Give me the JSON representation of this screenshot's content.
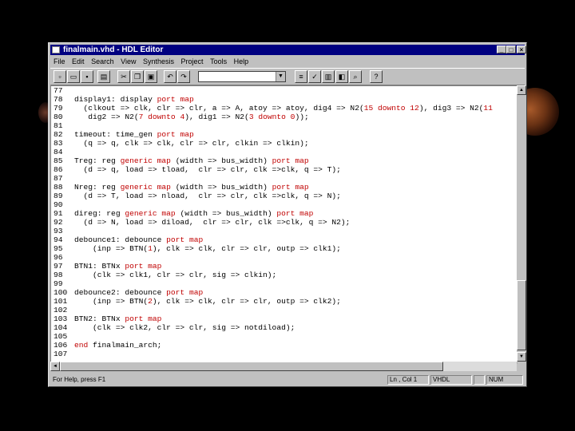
{
  "window": {
    "title": "finalmain.vhd - HDL Editor",
    "min": "_",
    "max": "□",
    "close": "×"
  },
  "menu": [
    "File",
    "Edit",
    "Search",
    "View",
    "Synthesis",
    "Project",
    "Tools",
    "Help"
  ],
  "toolbar": {
    "combo_value": "",
    "icons": [
      "new-file-icon",
      "open-folder-icon",
      "save-icon",
      "print-icon",
      "cut-icon",
      "copy-icon",
      "paste-icon",
      "undo-icon",
      "redo-icon",
      "compile-icon",
      "syntax-check-icon",
      "language-assistant-icon",
      "symbol-wizard-icon",
      "search-icon",
      "help-icon"
    ]
  },
  "editor": {
    "lines": [
      {
        "n": "77",
        "text": ""
      },
      {
        "n": "78",
        "text": "display1: display port map"
      },
      {
        "n": "79",
        "text": "  (clkout => clk, clr => clr, a => A, atoy => atoy, dig4 => N2(15 downto 12), dig3 => N2(11"
      },
      {
        "n": "80",
        "text": "   dig2 => N2(7 downto 4), dig1 => N2(3 downto 0));"
      },
      {
        "n": "81",
        "text": ""
      },
      {
        "n": "82",
        "text": "timeout: time_gen port map"
      },
      {
        "n": "83",
        "text": "  (q => q, clk => clk, clr => clr, clkin => clkin);"
      },
      {
        "n": "84",
        "text": ""
      },
      {
        "n": "85",
        "text": "Treg: reg generic map (width => bus_width) port map"
      },
      {
        "n": "86",
        "text": "  (d => q, load => tload,  clr => clr, clk =>clk, q => T);"
      },
      {
        "n": "87",
        "text": ""
      },
      {
        "n": "88",
        "text": "Nreg: reg generic map (width => bus_width) port map"
      },
      {
        "n": "89",
        "text": "  (d => T, load => nload,  clr => clr, clk =>clk, q => N);"
      },
      {
        "n": "90",
        "text": ""
      },
      {
        "n": "91",
        "text": "direg: reg generic map (width => bus_width) port map"
      },
      {
        "n": "92",
        "text": "  (d => N, load => diload,  clr => clr, clk =>clk, q => N2);"
      },
      {
        "n": "93",
        "text": ""
      },
      {
        "n": "94",
        "text": "debounce1: debounce port map"
      },
      {
        "n": "95",
        "text": "    (inp => BTN(1), clk => clk, clr => clr, outp => clk1);"
      },
      {
        "n": "96",
        "text": ""
      },
      {
        "n": "97",
        "text": "BTN1: BTNx port map"
      },
      {
        "n": "98",
        "text": "    (clk => clk1, clr => clr, sig => clkin);"
      },
      {
        "n": "99",
        "text": ""
      },
      {
        "n": "100",
        "text": "debounce2: debounce port map"
      },
      {
        "n": "101",
        "text": "    (inp => BTN(2), clk => clk, clr => clr, outp => clk2);"
      },
      {
        "n": "102",
        "text": ""
      },
      {
        "n": "103",
        "text": "BTN2: BTNx port map"
      },
      {
        "n": "104",
        "text": "    (clk => clk2, clr => clr, sig => notdiload);"
      },
      {
        "n": "105",
        "text": ""
      },
      {
        "n": "106",
        "text": "end finalmain_arch;"
      },
      {
        "n": "107",
        "text": ""
      }
    ],
    "keywords": [
      "port",
      "map",
      "generic",
      "downto",
      "end"
    ]
  },
  "status": {
    "help": "For Help, press F1",
    "position": "Ln , Col 1",
    "language": "VHDL",
    "num": "NUM"
  }
}
